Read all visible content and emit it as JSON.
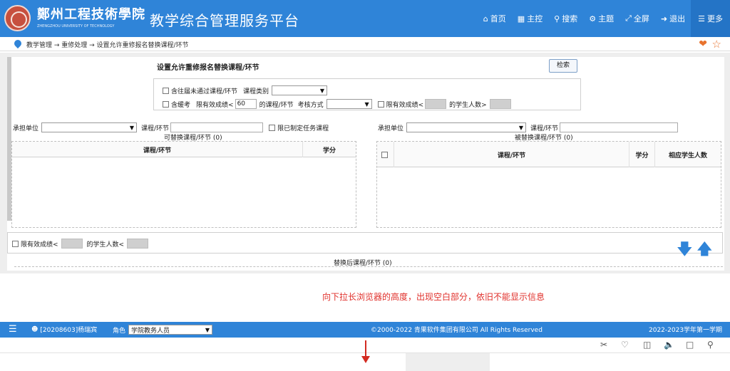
{
  "header": {
    "school_name": "鄭州工程技術學院",
    "school_name_en": "ZHENGZHOU UNIVERSITY OF TECHNOLOGY",
    "platform_title": "教学综合管理服务平台",
    "nav": [
      {
        "icon": "home-icon",
        "label": "首页"
      },
      {
        "icon": "dashboard-icon",
        "label": "主控"
      },
      {
        "icon": "search-icon",
        "label": "搜索"
      },
      {
        "icon": "theme-icon",
        "label": "主题"
      },
      {
        "icon": "fullscreen-icon",
        "label": "全屏"
      },
      {
        "icon": "logout-icon",
        "label": "退出"
      },
      {
        "icon": "menu-icon",
        "label": "更多"
      }
    ]
  },
  "breadcrumb": {
    "text": "教学管理 → 重修处理 → 设置允许重修报名替换课程/环节"
  },
  "form": {
    "title": "设置允许重修报名替换课程/环节",
    "search_button": "检索",
    "row1": {
      "include_prev_failed": "含往届未通过课程/环节",
      "course_category_label": "课程类别",
      "course_category_value": ""
    },
    "row2": {
      "include_deferred": "含缓考",
      "limit_score_label": "限有效成绩<",
      "limit_score_value": "60",
      "course_suffix": "的课程/环节",
      "exam_mode_label": "考核方式",
      "exam_mode_value": "",
      "limit_valid_score": "限有效成绩<",
      "student_count_label": "的学生人数>"
    }
  },
  "left_panel": {
    "dept_label": "承担单位",
    "dept_value": "",
    "course_label": "课程/环节",
    "course_value": "",
    "limit_task": "限已制定任务课程",
    "caption": "可替换课程/环节 (0)",
    "columns": [
      "课程/环节",
      "学分"
    ]
  },
  "right_panel": {
    "dept_label": "承担单位",
    "dept_value": "",
    "course_label": "课程/环节",
    "course_value": "",
    "caption": "被替换课程/环节 (0)",
    "columns": [
      "课程/环节",
      "学分",
      "相应学生人数"
    ]
  },
  "bottom": {
    "limit_score": "限有效成绩<",
    "student_count_label": "的学生人数<",
    "after_caption": "替换后课程/环节 (0)"
  },
  "note": "向下拉长浏览器的高度，出现空白部分，依旧不能显示信息",
  "footer": {
    "user": "[20208603]杨瑞宾",
    "role_label": "角色",
    "role_value": "学院教务人员",
    "copyright": "©2000-2022 青果软件集团有限公司 All Rights Reserved",
    "term": "2022-2023学年第一学期"
  },
  "colors": {
    "brand": "#2f84d8",
    "accent": "#e8732e",
    "note": "#e0302b"
  }
}
